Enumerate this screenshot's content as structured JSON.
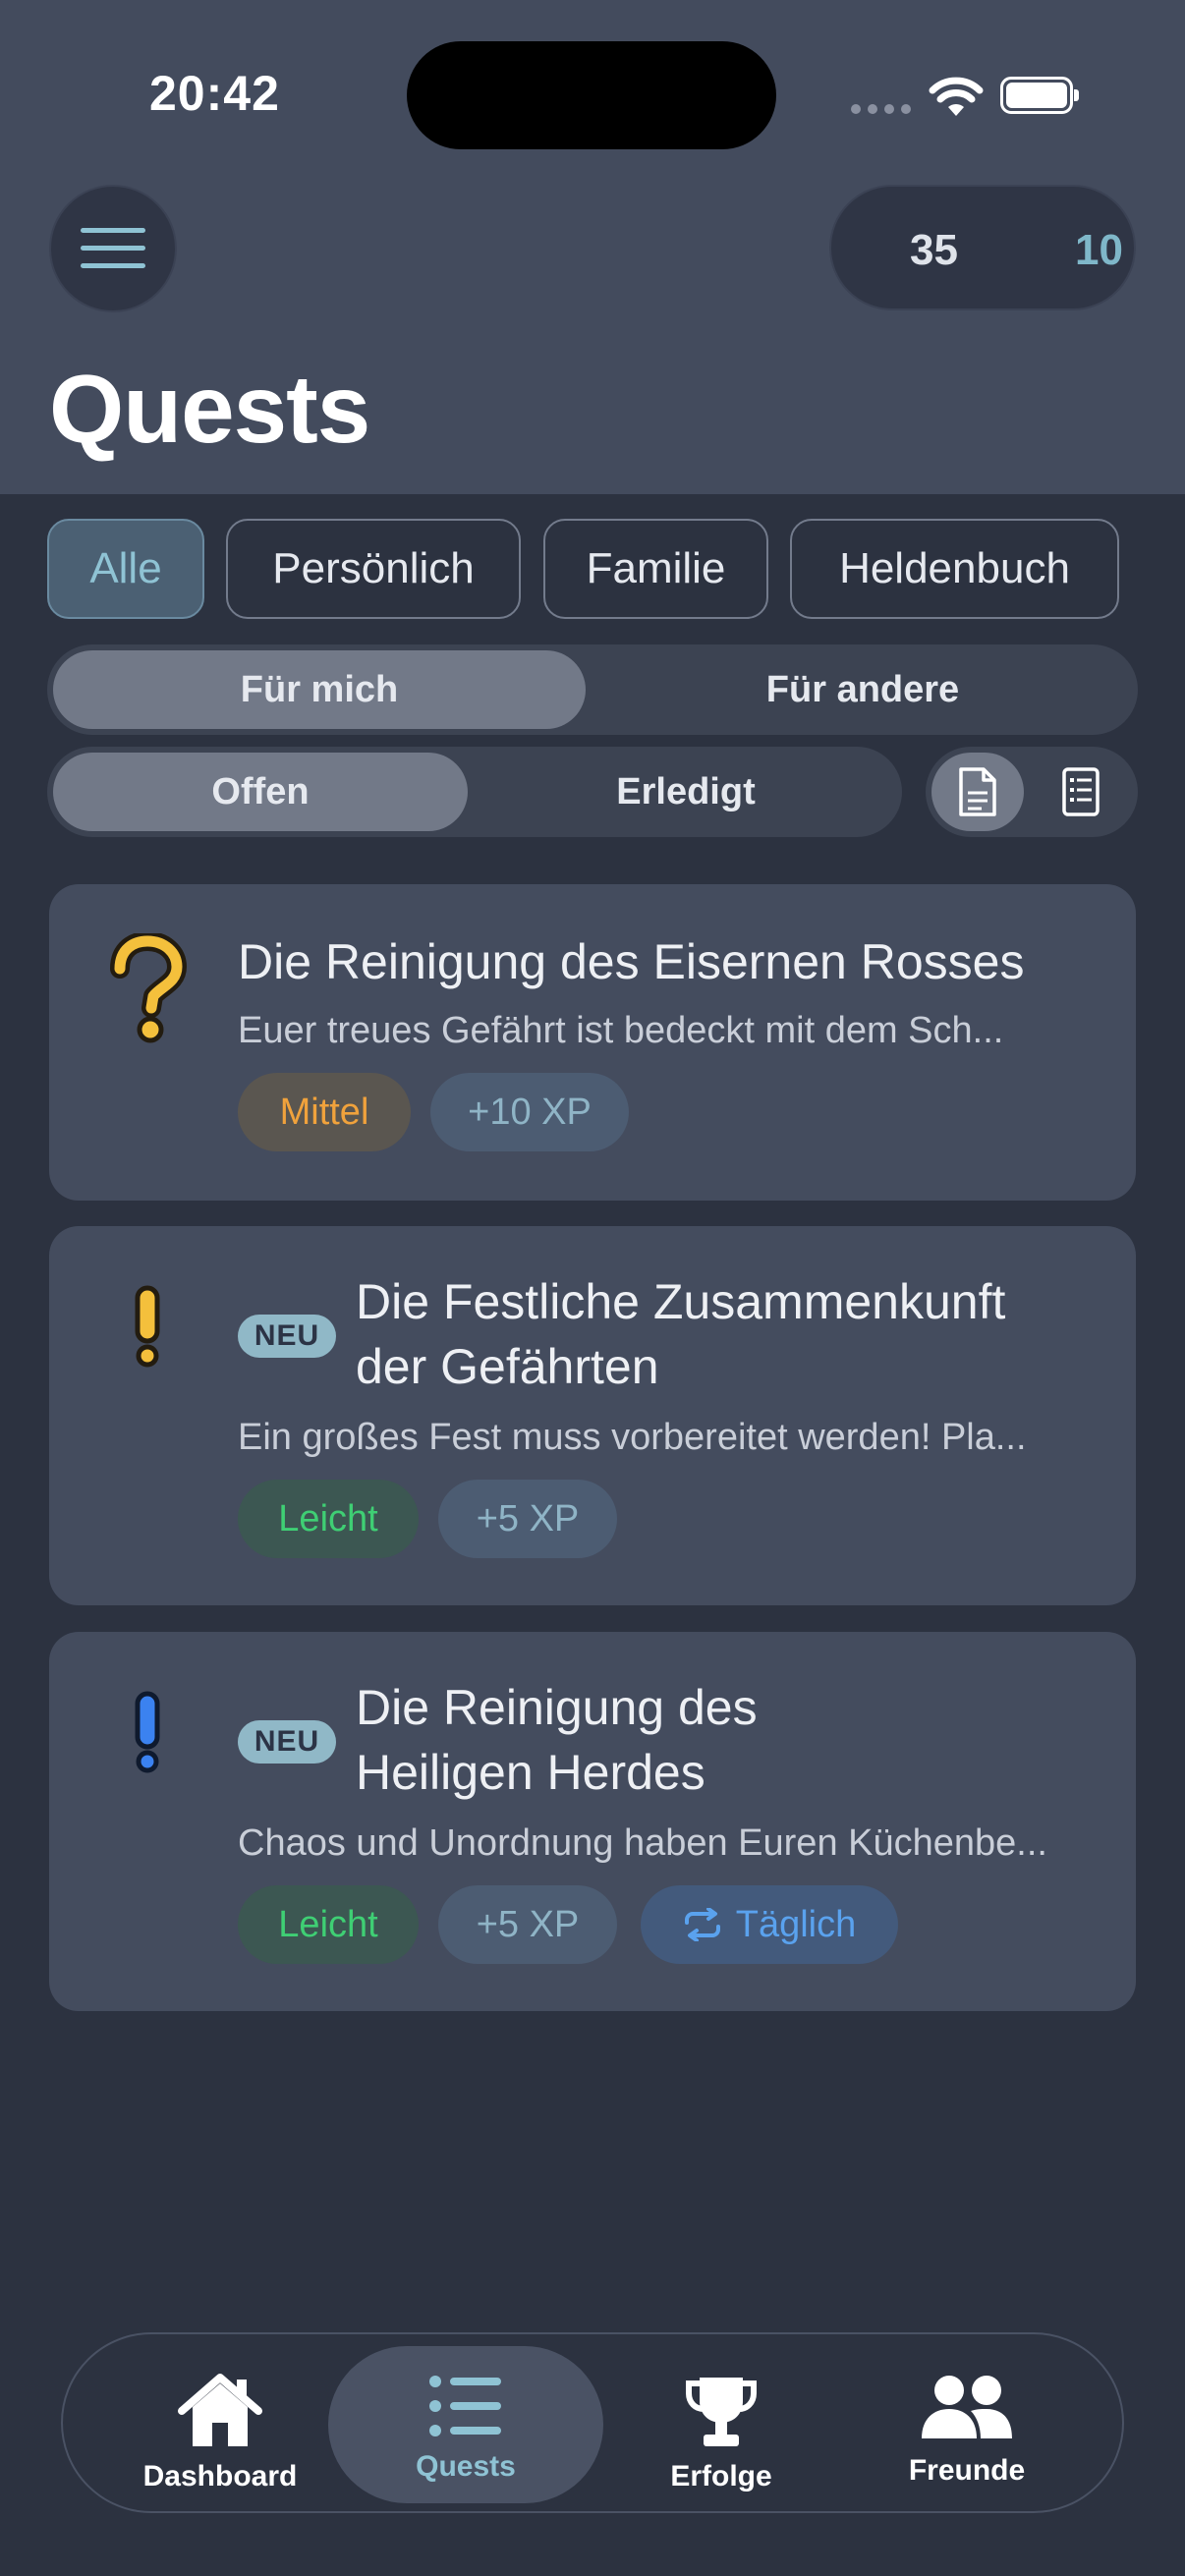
{
  "status_bar": {
    "time": "20:42"
  },
  "header": {
    "menu_icon": "hamburger-icon",
    "stat_left": "35",
    "stat_right": "10",
    "title": "Quests"
  },
  "filters": {
    "categories": [
      {
        "label": "Alle",
        "active": true
      },
      {
        "label": "Persönlich",
        "active": false
      },
      {
        "label": "Familie",
        "active": false
      },
      {
        "label": "Heldenbuch",
        "active": false
      }
    ],
    "audience": {
      "options": [
        "Für mich",
        "Für andere"
      ],
      "selected": "Für mich"
    },
    "status": {
      "options": [
        "Offen",
        "Erledigt"
      ],
      "selected": "Offen"
    },
    "view_modes": {
      "icons": [
        "document-icon",
        "list-icon"
      ],
      "selected": "document-icon"
    }
  },
  "quests": [
    {
      "icon": "question-mark-icon",
      "title_line1": "Die Reinigung des Eisernen Rosses",
      "title_line2": "",
      "badge": "",
      "description": "Euer treues Gefährt ist bedeckt mit dem Sch...",
      "difficulty": "Mittel",
      "xp": "+10 XP",
      "recurrence": ""
    },
    {
      "icon": "exclamation-yellow-icon",
      "badge": "NEU",
      "title_line1": "Die Festliche Zusammenkunft",
      "title_line2": "der Gefährten",
      "description": "Ein großes Fest muss vorbereitet werden! Pla...",
      "difficulty": "Leicht",
      "xp": "+5 XP",
      "recurrence": ""
    },
    {
      "icon": "exclamation-blue-icon",
      "badge": "NEU",
      "title_line1": "Die Reinigung des",
      "title_line2": "Heiligen Herdes",
      "description": "Chaos und Unordnung haben Euren Küchenbe...",
      "difficulty": "Leicht",
      "xp": "+5 XP",
      "recurrence": "Täglich"
    }
  ],
  "tabbar": {
    "items": [
      {
        "label": "Dashboard",
        "icon": "home-icon",
        "selected": false
      },
      {
        "label": "Quests",
        "icon": "list-icon",
        "selected": true
      },
      {
        "label": "Erfolge",
        "icon": "trophy-icon",
        "selected": false
      },
      {
        "label": "Freunde",
        "icon": "people-icon",
        "selected": false
      }
    ]
  },
  "colors": {
    "background": "#2c3240",
    "header": "#434b5d",
    "card": "#444c5e",
    "accent": "#8fc3d4"
  }
}
